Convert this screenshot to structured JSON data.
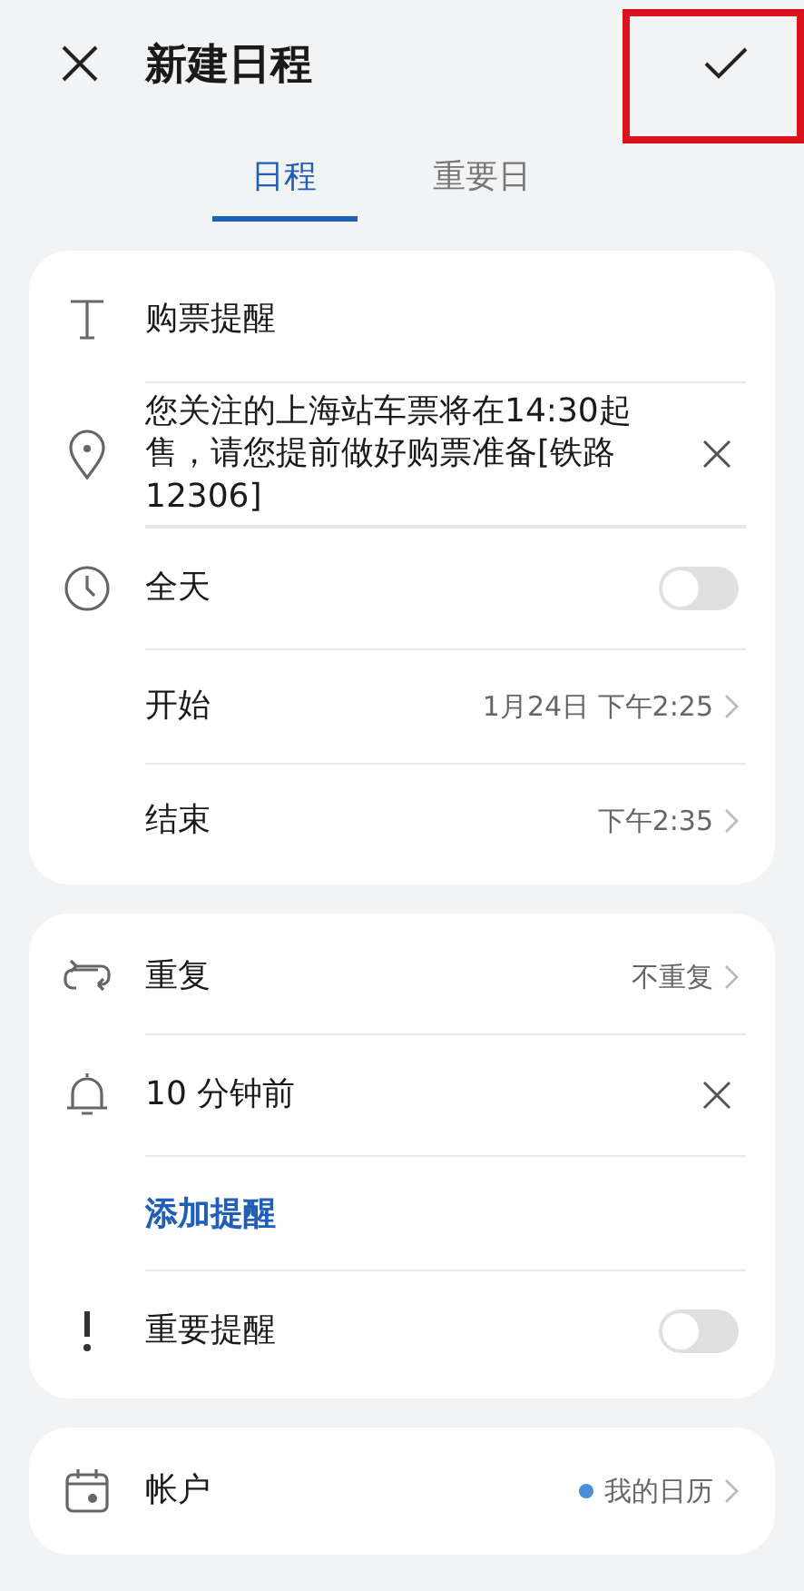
{
  "header": {
    "title": "新建日程"
  },
  "tabs": [
    {
      "label": "日程",
      "selected": true
    },
    {
      "label": "重要日",
      "selected": false
    }
  ],
  "cards": [
    {
      "rows": [
        {
          "kind": "text",
          "label": "购票提醒"
        },
        {
          "kind": "clearable",
          "label": "您关注的上海站车票将在14:30起售，请您提前做好购票准备[铁路12306]"
        },
        {
          "kind": "toggle",
          "label": "全天",
          "on": false
        },
        {
          "kind": "value",
          "label": "开始",
          "value": "1月24日 下午2:25"
        },
        {
          "kind": "value",
          "label": "结束",
          "value": "下午2:35"
        }
      ]
    },
    {
      "rows": [
        {
          "kind": "value",
          "label": "重复",
          "value": "不重复"
        },
        {
          "kind": "clearable",
          "label": "10 分钟前"
        },
        {
          "kind": "link",
          "label": "添加提醒"
        },
        {
          "kind": "toggle",
          "label": "重要提醒",
          "on": false
        }
      ]
    },
    {
      "rows": [
        {
          "kind": "value",
          "label": "帐户",
          "value": "我的日历",
          "color": "#4a90d9"
        }
      ]
    }
  ]
}
